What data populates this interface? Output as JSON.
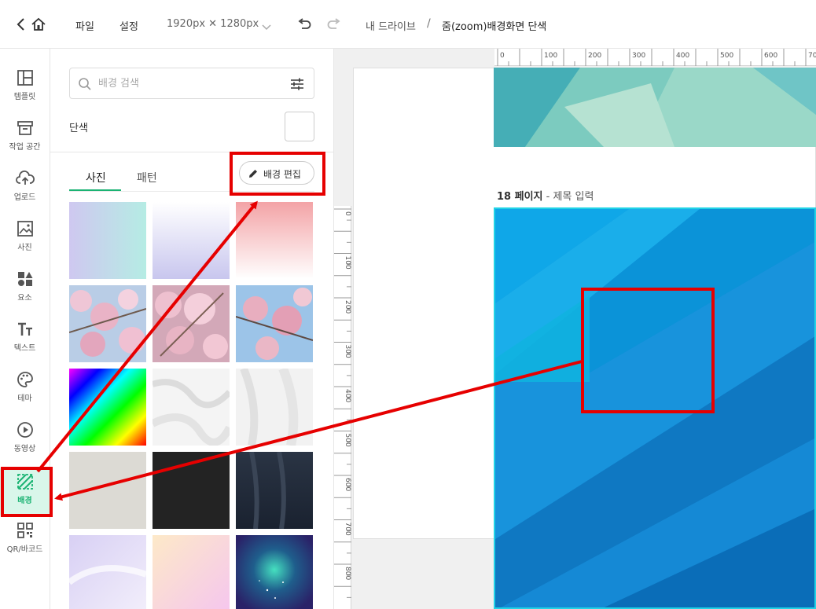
{
  "topbar": {
    "menu_file": "파일",
    "menu_settings": "설정",
    "canvas_size": "1920px ✕ 1280px",
    "breadcrumb_root": "내 드라이브",
    "breadcrumb_sep": "/",
    "document_title": "줌(zoom)배경화면 단색"
  },
  "leftnav": {
    "items": [
      {
        "label": "템플릿",
        "icon": "template-icon"
      },
      {
        "label": "작업 공간",
        "icon": "workspace-icon"
      },
      {
        "label": "업로드",
        "icon": "upload-icon"
      },
      {
        "label": "사진",
        "icon": "photo-icon"
      },
      {
        "label": "요소",
        "icon": "elements-icon"
      },
      {
        "label": "텍스트",
        "icon": "text-icon"
      },
      {
        "label": "테마",
        "icon": "palette-icon"
      },
      {
        "label": "동영상",
        "icon": "video-icon"
      },
      {
        "label": "배경",
        "icon": "background-icon",
        "active": true
      },
      {
        "label": "QR/바코드",
        "icon": "qr-icon"
      }
    ]
  },
  "panel": {
    "search_placeholder": "배경 검색",
    "solid_color_label": "단색",
    "tabs": [
      {
        "label": "사진",
        "active": true
      },
      {
        "label": "패턴",
        "active": false
      }
    ],
    "edit_background_label": "배경 편집"
  },
  "canvas": {
    "ruler_top_ticks": [
      "0",
      "100",
      "200",
      "300",
      "400",
      "500",
      "600",
      "700"
    ],
    "ruler_left_ticks": [
      "0",
      "100",
      "200",
      "300",
      "400",
      "500",
      "600",
      "700",
      "800"
    ],
    "page_number": "18 페이지",
    "page_title_placeholder": " - 제목 입력"
  },
  "colors": {
    "accent": "#1bb373",
    "annotation": "#e60000",
    "selection": "#22d3e6"
  }
}
